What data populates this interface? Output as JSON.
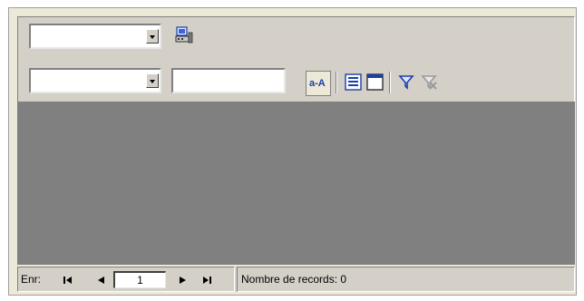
{
  "toolbar": {
    "combo_top": {
      "value": ""
    },
    "combo_bottom": {
      "value": ""
    },
    "search_text": {
      "value": ""
    },
    "buttons": {
      "sort_label": "a-A",
      "icons": [
        "computer-icon",
        "sort-az-icon",
        "list-view-icon",
        "form-view-icon",
        "filter-icon",
        "remove-filter-icon"
      ]
    }
  },
  "status": {
    "record_label": "Enr:",
    "current_record": "1",
    "record_count_text": "Nombre de records: 0"
  },
  "colors": {
    "face": "#d4d0c8",
    "grid_background": "#808080",
    "accent_blue": "#1c3fa8"
  }
}
